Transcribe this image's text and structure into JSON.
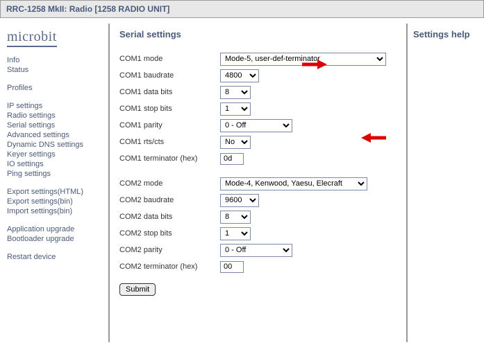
{
  "title": {
    "prefix": "RRC-1258 MkII:",
    "section": "Radio",
    "bracket": "[1258 RADIO UNIT]"
  },
  "logo": "microbit",
  "nav": {
    "g1": [
      {
        "label": "Info"
      },
      {
        "label": "Status"
      }
    ],
    "g2": [
      {
        "label": "Profiles"
      }
    ],
    "g3": [
      {
        "label": "IP settings"
      },
      {
        "label": "Radio settings"
      },
      {
        "label": "Serial settings"
      },
      {
        "label": "Advanced settings"
      },
      {
        "label": "Dynamic DNS settings"
      },
      {
        "label": "Keyer settings"
      },
      {
        "label": "IO settings"
      },
      {
        "label": "Ping settings"
      }
    ],
    "g4": [
      {
        "label": "Export settings(HTML)"
      },
      {
        "label": "Export settings(bin)"
      },
      {
        "label": "Import settings(bin)"
      }
    ],
    "g5": [
      {
        "label": "Application upgrade"
      },
      {
        "label": "Bootloader upgrade"
      }
    ],
    "g6": [
      {
        "label": "Restart device"
      }
    ]
  },
  "heading": "Serial settings",
  "com1": {
    "mode": {
      "label": "COM1 mode",
      "value": "Mode-5, user-def-terminator"
    },
    "baud": {
      "label": "COM1 baudrate",
      "value": "4800"
    },
    "data": {
      "label": "COM1 data bits",
      "value": "8"
    },
    "stop": {
      "label": "COM1 stop bits",
      "value": "1"
    },
    "parity": {
      "label": "COM1 parity",
      "value": "0 - Off"
    },
    "rtscts": {
      "label": "COM1 rts/cts",
      "value": "No"
    },
    "term": {
      "label": "COM1 terminator (hex)",
      "value": "0d"
    }
  },
  "com2": {
    "mode": {
      "label": "COM2 mode",
      "value": "Mode-4, Kenwood, Yaesu, Elecraft"
    },
    "baud": {
      "label": "COM2 baudrate",
      "value": "9600"
    },
    "data": {
      "label": "COM2 data bits",
      "value": "8"
    },
    "stop": {
      "label": "COM2 stop bits",
      "value": "1"
    },
    "parity": {
      "label": "COM2 parity",
      "value": "0 - Off"
    },
    "term": {
      "label": "COM2 terminator (hex)",
      "value": "00"
    }
  },
  "submit": "Submit",
  "help_heading": "Settings help"
}
